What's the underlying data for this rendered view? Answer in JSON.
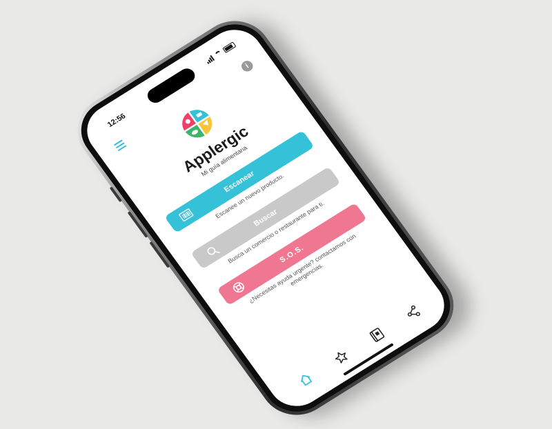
{
  "status_bar": {
    "time": "12:56"
  },
  "header": {
    "info_label": "i"
  },
  "app": {
    "title": "Applergic",
    "subtitle": "Mi guía alimentaria"
  },
  "actions": {
    "scan": {
      "label": "Escanear",
      "hint": "Escanee un nuevo producto."
    },
    "search": {
      "label": "Buscar",
      "hint": "Busca un comercio o restaurante para ti."
    },
    "sos": {
      "label": "S.O.S.",
      "hint": "¿Necesitas ayuda urgente? contactamos con emergencias."
    }
  },
  "tabbar": {
    "items": [
      "home-icon",
      "star-icon",
      "diary-icon",
      "share-icon"
    ],
    "active": "home-icon"
  },
  "colors": {
    "accent": "#35c2d8",
    "sos": "#f07792",
    "disabled": "#c9c9c9",
    "background": "#e9e9e8"
  }
}
